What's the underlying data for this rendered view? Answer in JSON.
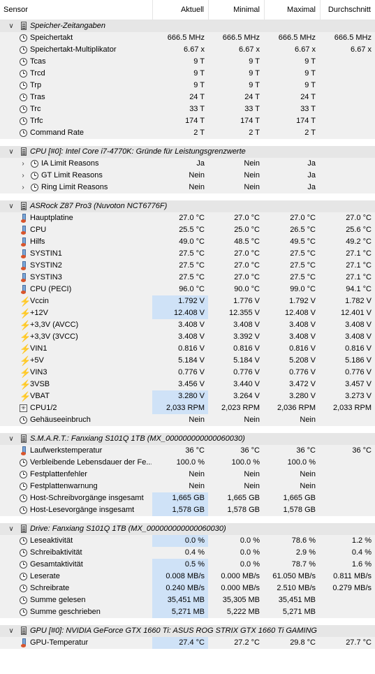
{
  "header": {
    "sensor": "Sensor",
    "current": "Aktuell",
    "min": "Minimal",
    "max": "Maximal",
    "avg": "Durchschnitt"
  },
  "groups": [
    {
      "title": "Speicher-Zeitangaben",
      "rows": [
        {
          "icon": "clock",
          "label": "Speichertakt",
          "v": [
            "666.5 MHz",
            "666.5 MHz",
            "666.5 MHz",
            "666.5 MHz"
          ]
        },
        {
          "icon": "clock",
          "label": "Speichertakt-Multiplikator",
          "v": [
            "6.67 x",
            "6.67 x",
            "6.67 x",
            "6.67 x"
          ]
        },
        {
          "icon": "clock",
          "label": "Tcas",
          "v": [
            "9 T",
            "9 T",
            "9 T",
            ""
          ]
        },
        {
          "icon": "clock",
          "label": "Trcd",
          "v": [
            "9 T",
            "9 T",
            "9 T",
            ""
          ]
        },
        {
          "icon": "clock",
          "label": "Trp",
          "v": [
            "9 T",
            "9 T",
            "9 T",
            ""
          ]
        },
        {
          "icon": "clock",
          "label": "Tras",
          "v": [
            "24 T",
            "24 T",
            "24 T",
            ""
          ]
        },
        {
          "icon": "clock",
          "label": "Trc",
          "v": [
            "33 T",
            "33 T",
            "33 T",
            ""
          ]
        },
        {
          "icon": "clock",
          "label": "Trfc",
          "v": [
            "174 T",
            "174 T",
            "174 T",
            ""
          ]
        },
        {
          "icon": "clock",
          "label": "Command Rate",
          "v": [
            "2 T",
            "2 T",
            "2 T",
            ""
          ]
        }
      ]
    },
    {
      "title": "CPU [#0]: Intel Core i7-4770K: Gründe für Leistungsgrenzwerte",
      "rows": [
        {
          "icon": "clock",
          "sub": true,
          "label": "IA Limit Reasons",
          "v": [
            "Ja",
            "Nein",
            "Ja",
            ""
          ]
        },
        {
          "icon": "clock",
          "sub": true,
          "label": "GT Limit Reasons",
          "v": [
            "Nein",
            "Nein",
            "Ja",
            ""
          ]
        },
        {
          "icon": "clock",
          "sub": true,
          "label": "Ring Limit Reasons",
          "v": [
            "Nein",
            "Nein",
            "Ja",
            ""
          ]
        }
      ]
    },
    {
      "title": "ASRock Z87 Pro3 (Nuvoton NCT6776F)",
      "rows": [
        {
          "icon": "therm",
          "label": "Hauptplatine",
          "v": [
            "27.0 °C",
            "27.0 °C",
            "27.0 °C",
            "27.0 °C"
          ]
        },
        {
          "icon": "therm",
          "label": "CPU",
          "v": [
            "25.5 °C",
            "25.0 °C",
            "26.5 °C",
            "25.6 °C"
          ]
        },
        {
          "icon": "therm",
          "label": "Hilfs",
          "v": [
            "49.0 °C",
            "48.5 °C",
            "49.5 °C",
            "49.2 °C"
          ]
        },
        {
          "icon": "therm",
          "label": "SYSTIN1",
          "v": [
            "27.5 °C",
            "27.0 °C",
            "27.5 °C",
            "27.1 °C"
          ]
        },
        {
          "icon": "therm",
          "label": "SYSTIN2",
          "v": [
            "27.5 °C",
            "27.0 °C",
            "27.5 °C",
            "27.1 °C"
          ]
        },
        {
          "icon": "therm",
          "label": "SYSTIN3",
          "v": [
            "27.5 °C",
            "27.0 °C",
            "27.5 °C",
            "27.1 °C"
          ]
        },
        {
          "icon": "therm",
          "label": "CPU (PECI)",
          "v": [
            "96.0 °C",
            "90.0 °C",
            "99.0 °C",
            "94.1 °C"
          ]
        },
        {
          "icon": "bolt",
          "hl": true,
          "label": "Vccin",
          "v": [
            "1.792 V",
            "1.776 V",
            "1.792 V",
            "1.782 V"
          ]
        },
        {
          "icon": "bolt",
          "hl": true,
          "label": "+12V",
          "v": [
            "12.408 V",
            "12.355 V",
            "12.408 V",
            "12.401 V"
          ]
        },
        {
          "icon": "bolt",
          "label": "+3,3V (AVCC)",
          "v": [
            "3.408 V",
            "3.408 V",
            "3.408 V",
            "3.408 V"
          ]
        },
        {
          "icon": "bolt",
          "label": "+3,3V (3VCC)",
          "v": [
            "3.408 V",
            "3.392 V",
            "3.408 V",
            "3.408 V"
          ]
        },
        {
          "icon": "bolt",
          "label": "VIN1",
          "v": [
            "0.816 V",
            "0.816 V",
            "0.816 V",
            "0.816 V"
          ]
        },
        {
          "icon": "bolt",
          "label": "+5V",
          "v": [
            "5.184 V",
            "5.184 V",
            "5.208 V",
            "5.186 V"
          ]
        },
        {
          "icon": "bolt",
          "label": "VIN3",
          "v": [
            "0.776 V",
            "0.776 V",
            "0.776 V",
            "0.776 V"
          ]
        },
        {
          "icon": "bolt",
          "label": "3VSB",
          "v": [
            "3.456 V",
            "3.440 V",
            "3.472 V",
            "3.457 V"
          ]
        },
        {
          "icon": "bolt",
          "hl": true,
          "label": "VBAT",
          "v": [
            "3.280 V",
            "3.264 V",
            "3.280 V",
            "3.273 V"
          ]
        },
        {
          "icon": "fan",
          "hl": true,
          "label": "CPU1/2",
          "v": [
            "2,033 RPM",
            "2,023 RPM",
            "2,036 RPM",
            "2,033 RPM"
          ]
        },
        {
          "icon": "clock",
          "label": "Gehäuseeinbruch",
          "v": [
            "Nein",
            "Nein",
            "Nein",
            ""
          ]
        }
      ]
    },
    {
      "title": "S.M.A.R.T.: Fanxiang S101Q 1TB (MX_000000000000060030)",
      "rows": [
        {
          "icon": "therm",
          "label": "Laufwerkstemperatur",
          "v": [
            "36 °C",
            "36 °C",
            "36 °C",
            "36 °C"
          ]
        },
        {
          "icon": "clock",
          "label": "Verbleibende Lebensdauer der Fe...",
          "v": [
            "100.0 %",
            "100.0 %",
            "100.0 %",
            ""
          ]
        },
        {
          "icon": "clock",
          "label": "Festplattenfehler",
          "v": [
            "Nein",
            "Nein",
            "Nein",
            ""
          ]
        },
        {
          "icon": "clock",
          "label": "Festplattenwarnung",
          "v": [
            "Nein",
            "Nein",
            "Nein",
            ""
          ]
        },
        {
          "icon": "clock",
          "hl": true,
          "label": "Host-Schreibvorgänge insgesamt",
          "v": [
            "1,665 GB",
            "1,665 GB",
            "1,665 GB",
            ""
          ]
        },
        {
          "icon": "clock",
          "hl": true,
          "label": "Host-Lesevorgänge insgesamt",
          "v": [
            "1,578 GB",
            "1,578 GB",
            "1,578 GB",
            ""
          ]
        }
      ]
    },
    {
      "title": "Drive: Fanxiang S101Q 1TB (MX_000000000000060030)",
      "rows": [
        {
          "icon": "clock",
          "hl": true,
          "label": "Leseaktivität",
          "v": [
            "0.0 %",
            "0.0 %",
            "78.6 %",
            "1.2 %"
          ]
        },
        {
          "icon": "clock",
          "label": "Schreibaktivität",
          "v": [
            "0.4 %",
            "0.0 %",
            "2.9 %",
            "0.4 %"
          ]
        },
        {
          "icon": "clock",
          "hl": true,
          "label": "Gesamtaktivität",
          "v": [
            "0.5 %",
            "0.0 %",
            "78.7 %",
            "1.6 %"
          ]
        },
        {
          "icon": "clock",
          "hl": true,
          "label": "Leserate",
          "v": [
            "0.008 MB/s",
            "0.000 MB/s",
            "61.050 MB/s",
            "0.811 MB/s"
          ]
        },
        {
          "icon": "clock",
          "hl": true,
          "label": "Schreibrate",
          "v": [
            "0.240 MB/s",
            "0.000 MB/s",
            "2.510 MB/s",
            "0.279 MB/s"
          ]
        },
        {
          "icon": "clock",
          "hl": true,
          "label": "Summe gelesen",
          "v": [
            "35,451 MB",
            "35,305 MB",
            "35,451 MB",
            ""
          ]
        },
        {
          "icon": "clock",
          "hl": true,
          "label": "Summe geschrieben",
          "v": [
            "5,271 MB",
            "5,222 MB",
            "5,271 MB",
            ""
          ]
        }
      ]
    },
    {
      "title": "GPU [#0]: NVIDIA GeForce GTX 1660 Ti: ASUS ROG STRIX GTX 1660 Ti GAMING",
      "rows": [
        {
          "icon": "therm",
          "hl": true,
          "label": "GPU-Temperatur",
          "v": [
            "27.4 °C",
            "27.2 °C",
            "29.8 °C",
            "27.7 °C"
          ]
        }
      ]
    }
  ]
}
